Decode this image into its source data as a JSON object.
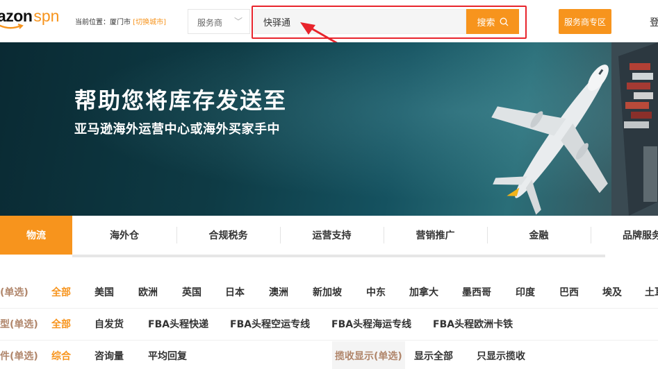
{
  "header": {
    "logo_word": "azon",
    "logo_suffix": "spn",
    "location_prefix": "当前位置：",
    "location_city": "厦门市",
    "location_switch": "[切换城市]",
    "provider_select": "服务商",
    "search_value": "快驿通",
    "search_button": "搜索",
    "zone_button": "服务商专区",
    "login": "登"
  },
  "banner": {
    "headline": "帮助您将库存发送至",
    "subline": "亚马逊海外运营中心或海外买家手中"
  },
  "tabs": [
    {
      "label": "物流",
      "active": true
    },
    {
      "label": "海外仓",
      "active": false
    },
    {
      "label": "合规税务",
      "active": false
    },
    {
      "label": "运营支持",
      "active": false
    },
    {
      "label": "营销推广",
      "active": false
    },
    {
      "label": "金融",
      "active": false
    },
    {
      "label": "品牌服务",
      "active": false
    }
  ],
  "filters": {
    "region": {
      "label": "(单选)",
      "options": [
        "全部",
        "美国",
        "欧洲",
        "英国",
        "日本",
        "澳洲",
        "新加坡",
        "中东",
        "加拿大",
        "墨西哥",
        "印度",
        "巴西",
        "埃及",
        "土耳"
      ],
      "selected": "全部"
    },
    "type": {
      "label": "型(单选)",
      "options": [
        "全部",
        "自发货",
        "FBA头程快递",
        "FBA头程空运专线",
        "FBA头程海运专线",
        "FBA头程欧洲卡铁"
      ],
      "selected": "全部"
    },
    "sort": {
      "label": "件(单选)",
      "options": [
        "综合",
        "咨询量",
        "平均回复"
      ],
      "selected": "综合",
      "pickup_label": "揽收显示(单选)",
      "pickup_options": [
        "显示全部",
        "只显示揽收"
      ]
    }
  },
  "colors": {
    "accent": "#f7941d",
    "annotation_red": "#e8242c",
    "label_brown": "#b0856a"
  }
}
